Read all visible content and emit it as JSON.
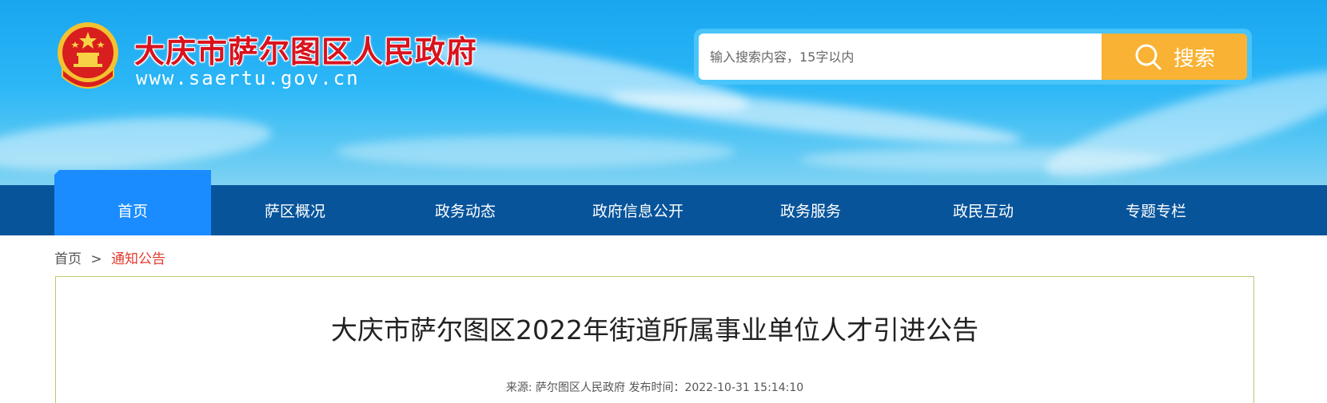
{
  "header": {
    "site_title": "大庆市萨尔图区人民政府",
    "site_url": "www.saertu.gov.cn",
    "emblem_icon": "national-emblem-icon"
  },
  "search": {
    "placeholder": "输入搜索内容，15字以内",
    "value": "",
    "button_label": "搜索",
    "button_icon": "search-icon",
    "button_color": "#f9b233"
  },
  "nav": {
    "items": [
      {
        "label": "首页",
        "active": true
      },
      {
        "label": "萨区概况",
        "active": false
      },
      {
        "label": "政务动态",
        "active": false
      },
      {
        "label": "政府信息公开",
        "active": false
      },
      {
        "label": "政务服务",
        "active": false
      },
      {
        "label": "政民互动",
        "active": false
      },
      {
        "label": "专题专栏",
        "active": false
      }
    ],
    "bar_color": "#07549b",
    "active_color": "#1a8cff"
  },
  "breadcrumb": {
    "home": "首页",
    "separator": ">",
    "current": "通知公告"
  },
  "article": {
    "title": "大庆市萨尔图区2022年街道所属事业单位人才引进公告",
    "meta": "来源: 萨尔图区人民政府 发布时间：2022-10-31 15:14:10"
  }
}
